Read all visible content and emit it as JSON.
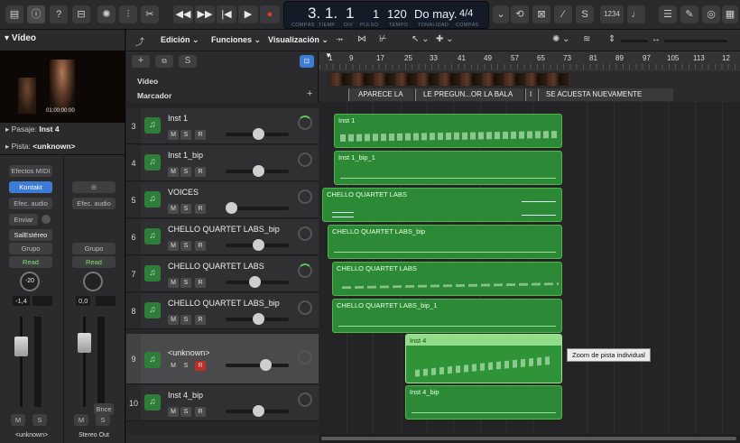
{
  "control_bar": {
    "buttons": [
      "library",
      "info",
      "help",
      "editors",
      "smart-controls",
      "mixer",
      "scissors"
    ],
    "transport": [
      "rewind",
      "forward",
      "go-to-start",
      "play",
      "record"
    ],
    "lcd": {
      "position": "3. 1.",
      "beat": "1",
      "division": "1",
      "tempo": "120",
      "key": "Do may.",
      "signature": "4/4",
      "labels": {
        "bar": "COMPÁS",
        "time": "TIEMP",
        "div": "DIV",
        "pulse": "PULSO",
        "tempo": "TEMPO",
        "key": "TONALIDAD",
        "signature": "COMPÁS"
      }
    },
    "right_text": "1234"
  },
  "inspector": {
    "title": "Vídeo",
    "video_timecode": "01:00:00:00",
    "pasaje_label": "Pasaje:",
    "pasaje_value": "Inst 4",
    "pista_label": "Pista:",
    "pista_value": "<unknown>",
    "strip1": {
      "effects_midi": "Efectos MIDI",
      "instrument": "Kontakt",
      "audio_fx": "Efec. audio",
      "send": "Enviar",
      "output": "SalEstéreo",
      "group": "Grupo",
      "read": "Read",
      "pan_value": "-20",
      "volume": "-1,4",
      "name": "<unknown>"
    },
    "strip2": {
      "audio_fx": "Efec. audio",
      "group": "Grupo",
      "read": "Read",
      "volume": "0,0",
      "bounce": "Bnce",
      "name": "Stereo Out"
    },
    "mute": "M",
    "solo": "S"
  },
  "toolbar": {
    "menus": [
      "Edición",
      "Funciones",
      "Visualización"
    ]
  },
  "header": {
    "video_label": "Vídeo",
    "marker_label": "Marcador",
    "markers": [
      "APARECE LA",
      "LE PREGUN...OR LA BALA",
      "I",
      "SE ACUESTA NUEVAMENTE"
    ],
    "ruler": [
      "1",
      "9",
      "17",
      "25",
      "33",
      "41",
      "49",
      "57",
      "65",
      "73",
      "81",
      "89",
      "97",
      "105",
      "113",
      "12"
    ]
  },
  "tracks": [
    {
      "num": "3",
      "name": "Inst 1",
      "region": "Inst 1"
    },
    {
      "num": "4",
      "name": "Inst 1_bip",
      "region": "Inst 1_bip_1"
    },
    {
      "num": "5",
      "name": "VOICES",
      "region": "CHELLO QUARTET LABS"
    },
    {
      "num": "6",
      "name": "CHELLO QUARTET LABS_bip",
      "region": "CHELLO QUARTET LABS_bip"
    },
    {
      "num": "7",
      "name": "CHELLO QUARTET LABS",
      "region": "CHELLO QUARTET LABS"
    },
    {
      "num": "8",
      "name": "CHELLO QUARTET LABS_bip",
      "region": "CHELLO QUARTET LABS_bip_1"
    },
    {
      "num": "9",
      "name": "<unknown>",
      "region": "Inst 4"
    },
    {
      "num": "10",
      "name": "Inst 4_bip",
      "region": "Inst 4_bip"
    }
  ],
  "track_buttons": {
    "m": "M",
    "s": "S",
    "r": "R"
  },
  "tooltip": "Zoom de pista individual",
  "colors": {
    "region": "#2c8a36",
    "accent": "#3d7cd6",
    "record": "#e03a2f"
  }
}
